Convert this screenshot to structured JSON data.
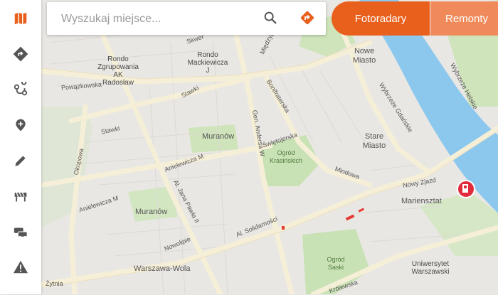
{
  "colors": {
    "accent": "#e8601c",
    "accent_light": "#f08a5a",
    "water": "#8cc8ee",
    "park": "#c9e2b5",
    "road": "#f6efd8"
  },
  "search": {
    "placeholder": "Wyszukaj miejsce..."
  },
  "sidebar": {
    "items": [
      {
        "icon": "map-icon"
      },
      {
        "icon": "directions-icon"
      },
      {
        "icon": "route-icon"
      },
      {
        "icon": "add-place-icon"
      },
      {
        "icon": "edit-icon"
      },
      {
        "icon": "roadwork-barrier-icon"
      },
      {
        "icon": "traffic-icon"
      },
      {
        "icon": "warning-icon"
      }
    ]
  },
  "tabs": [
    {
      "label": "Fotoradary"
    },
    {
      "label": "Remonty"
    }
  ],
  "map": {
    "labels": {
      "rondo_radoslaw": "Rondo\nZgrupowania\nAK Radosław",
      "rondo_mackiewicza": "Rondo\nMackiewicza\nJ",
      "nowe_miasto": "Nowe\nMiasto",
      "powazkowska": "Powązkowska",
      "stawki_1": "Stawki",
      "stawki_2": "Stawki",
      "muranow_1": "Muranów",
      "muranow_2": "Muranów",
      "stare_miasto": "Stare\nMiasto",
      "swietojerska": "Świętojerska",
      "ogrod_krasinskich": "Ogród\nKrasińskich",
      "anielewicza_1": "Anielewicza M",
      "anielewicza_2": "Anielewicza M",
      "okopowa": "Okopowa",
      "jana_pawla": "Al. Jana Pawła II",
      "gen_andersa": "Gen. Andersa W",
      "bonifraterska": "Bonifraterska",
      "miedzyparkowa": "Międzyp.",
      "skwer": "Skwer",
      "wybrzeze_gdanskie": "Wybrzeże Gdańskie",
      "wybrzeze_helskie": "Wybrzeże Helskie",
      "miodowa": "Miodowa",
      "nowy_zjazd": "Nowy Zjazd",
      "mariensztat": "Mariensztat",
      "nowolipie": "Nowolipie",
      "solidarnosci": "Al. Solidarności",
      "warszawa_wola": "Warszawa-Wola",
      "ogrod_saski": "Ogród\nSaski",
      "uniwersytet": "Uniwersytet\nWarszawski",
      "zytnia": "Żytnia",
      "krolewska": "Królewska"
    }
  }
}
